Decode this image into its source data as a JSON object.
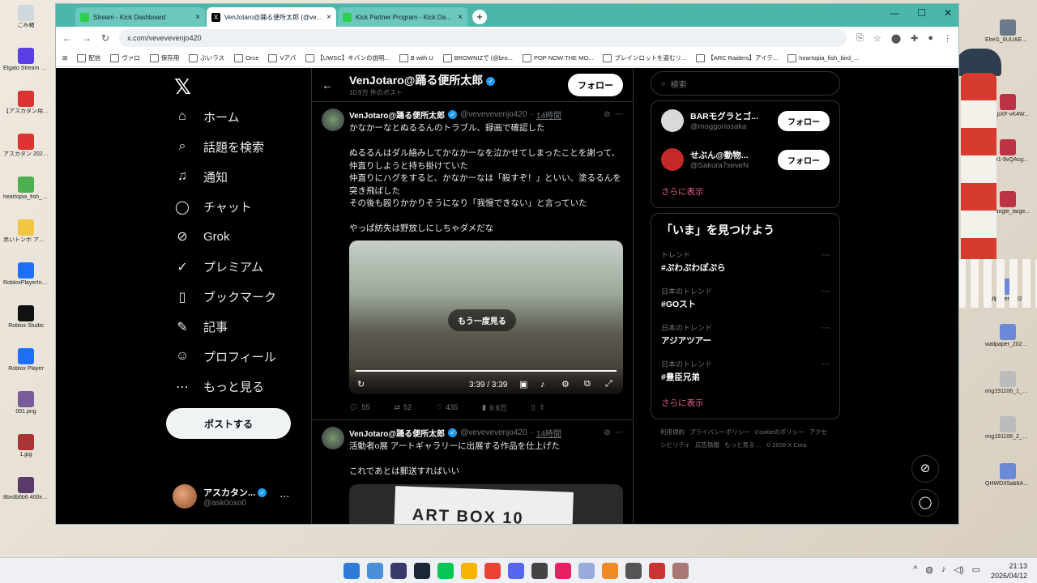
{
  "desktop": {
    "left_icons": [
      {
        "label": "ごみ箱",
        "color": "#cfd8dc"
      },
      {
        "label": "Elgato Stream Deck",
        "color": "#5b3ee6"
      },
      {
        "label": "【アスカタン用】KADOKAWA...",
        "color": "#d33"
      },
      {
        "label": "アスカタン 2024年12月ロ ギラバルム...",
        "color": "#d33"
      },
      {
        "label": "heartopia_fish_b...",
        "color": "#4caf50"
      },
      {
        "label": "赤いトンボ アップ",
        "color": "#f4c542"
      },
      {
        "label": "RobloxPlayerInst...",
        "color": "#1e6fff"
      },
      {
        "label": "Roblox Studio",
        "color": "#111"
      },
      {
        "label": "Roblox Player",
        "color": "#1e6fff"
      },
      {
        "label": "001.png",
        "color": "#7a5b9a"
      },
      {
        "label": "1.jpg",
        "color": "#a33"
      },
      {
        "label": "8bxdb6b6 400x4...",
        "color": "#5a3a6a"
      }
    ],
    "right_icons": [
      {
        "label": "Ehel1_6UUAED...",
        "color": "#6a7a8a"
      },
      {
        "label": "FX_pXF-vK4W...",
        "color": "#b34"
      },
      {
        "label": "Entr1-9vQAcg...",
        "color": "#b34"
      },
      {
        "label": "rectangle_large...",
        "color": "#b34"
      },
      {
        "label": "wallpaper_20250...",
        "color": "#6a8ad8"
      },
      {
        "label": "wallpaper_20250...",
        "color": "#6a8ad8"
      },
      {
        "label": "img191106_1_20...",
        "color": "#bbb"
      },
      {
        "label": "img191106_2_20...",
        "color": "#bbb"
      },
      {
        "label": "QHWDX5ab6AE2...",
        "color": "#6a8ad8"
      }
    ]
  },
  "browser": {
    "tabs": [
      {
        "title": "Stream - Kick Dashboard",
        "active": false,
        "fav": "K"
      },
      {
        "title": "VenJotaro@踊る便所太郎 (@ve...",
        "active": true,
        "fav": "X"
      },
      {
        "title": "Kick Partner Program - Kick Da...",
        "active": false,
        "fav": "K"
      }
    ],
    "url": "x.com/vevevevenjo420",
    "bookmarks": [
      "配信",
      "ヴァロ",
      "保存用",
      "ぶいラス",
      "Orce",
      "Vアパ",
      "【UWSC】キバンの説明...",
      "B with U",
      "BROWNIZで (@bro...",
      "POP NOW:THE MO...",
      "ブレインロットを盗むリ...",
      "【ARC Raiders】アイテ...",
      "heartopia_fish_bird_..."
    ]
  },
  "x": {
    "nav": [
      {
        "label": "ホーム",
        "icon": "home-icon",
        "glyph": "⌂"
      },
      {
        "label": "話題を検索",
        "icon": "search-icon",
        "glyph": "⌕"
      },
      {
        "label": "通知",
        "icon": "bell-icon",
        "glyph": "♫"
      },
      {
        "label": "チャット",
        "icon": "chat-icon",
        "glyph": "◯"
      },
      {
        "label": "Grok",
        "icon": "grok-icon",
        "glyph": "⊘"
      },
      {
        "label": "プレミアム",
        "icon": "premium-icon",
        "glyph": "✓"
      },
      {
        "label": "ブックマーク",
        "icon": "bookmark-icon",
        "glyph": "▯"
      },
      {
        "label": "記事",
        "icon": "article-icon",
        "glyph": "✎"
      },
      {
        "label": "プロフィール",
        "icon": "profile-icon",
        "glyph": "☺"
      },
      {
        "label": "もっと見る",
        "icon": "more-icon",
        "glyph": "⋯"
      }
    ],
    "post_button": "ポストする",
    "account": {
      "name": "アスカタン...",
      "handle": "@ask0oxo0"
    },
    "header": {
      "name": "VenJotaro@踊る便所太郎",
      "count": "10.9万 件のポスト",
      "follow": "フォロー"
    },
    "posts": [
      {
        "name": "VenJotaro@踊る便所太郎",
        "handle": "@vevevevenjo420",
        "time": "14時間",
        "text": "かなかーなとぬるるんのトラブル、録画で確認した\n\nぬるるんはダル絡みしてかなかーなを泣かせてしまったことを謝って、仲直りしようと持ち掛けていた\n仲直りにハグをすると、かなかーなは「殺すぞ！」といい、塗るるんを突き飛ばした\nその後も殴りかかりそうになり「我慢できない」と言っていた\n\nやっぱ紡失は野放しにしちゃダメだな",
        "video": {
          "replay": "もう一度見る",
          "time": "3:39 / 3:39"
        },
        "replies": "55",
        "reposts": "52",
        "likes": "435",
        "views": "9.9万"
      },
      {
        "name": "VenJotaro@踊る便所太郎",
        "handle": "@vevevevenjo420",
        "time": "14時間",
        "text": "活動者o展 アートギャラリーに出展する作品を仕上げた\n\nこれであとは郵送すればいい",
        "image_text": "ART BOX 10"
      }
    ],
    "search_placeholder": "検索",
    "who_to_follow": [
      {
        "name": "BARモグラとゴ...",
        "handle": "@moggoriosaka",
        "btn": "フォロー",
        "color": "#d9d9d9"
      },
      {
        "name": "せぶん@動物...",
        "handle": "@Sakura7seveN",
        "btn": "フォロー",
        "color": "#c62828"
      }
    ],
    "show_more": "さらに表示",
    "trends_title": "「いま」を見つけよう",
    "trends": [
      {
        "category": "トレンド",
        "name": "#ぷわぷわぽぷら"
      },
      {
        "category": "日本のトレンド",
        "name": "#GOスト"
      },
      {
        "category": "日本のトレンド",
        "name": "アジアツアー"
      },
      {
        "category": "日本のトレンド",
        "name": "#豊臣兄弟"
      }
    ],
    "trends_more": "さらに表示",
    "footer": [
      "利用規約",
      "プライバシーポリシー",
      "Cookieのポリシー",
      "アクセシビリティ",
      "広告情報",
      "もっと見る ...",
      "© 2026 X Corp."
    ]
  },
  "taskbar": {
    "icons": [
      "#2f7bd8",
      "#4a90d9",
      "#3a3a6a",
      "#1b2838",
      "#06c755",
      "#f6b400",
      "#ea4335",
      "#5865f2",
      "#444",
      "#e91e63",
      "#9ad",
      "#f08a24",
      "#555",
      "#c33",
      "#a77"
    ],
    "time": "21:13",
    "date": "2026/04/12"
  }
}
